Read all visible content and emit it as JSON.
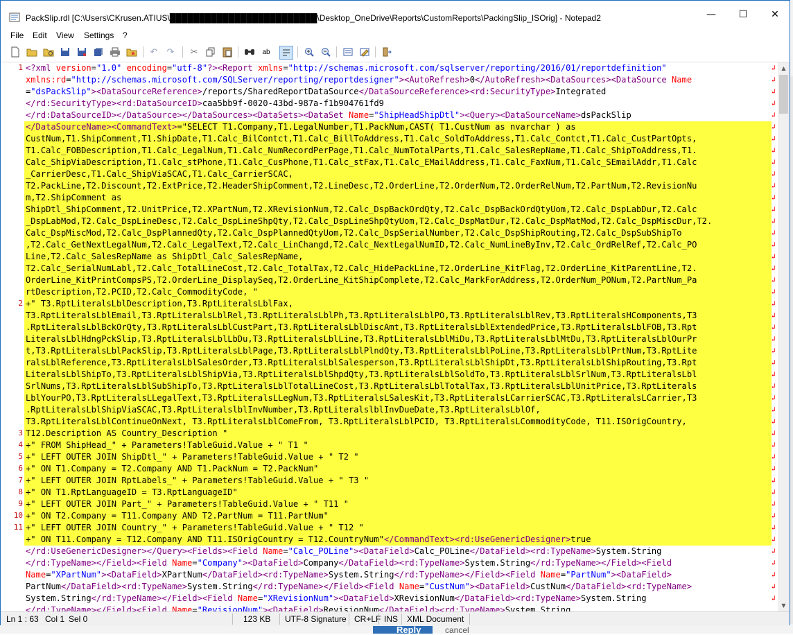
{
  "window": {
    "title": "PackSlip.rdl [C:\\Users\\CKrusen.ATIUS\\█████████████████████████\\Desktop_OneDrive\\Reports\\CustomReports\\PackingSlip_ISOrig] - Notepad2",
    "minimize_glyph": "—",
    "maximize_glyph": "☐",
    "close_glyph": "✕"
  },
  "menu": [
    "File",
    "Edit",
    "View",
    "Settings",
    "?"
  ],
  "toolbar": {
    "icons": [
      "new-file-icon",
      "open-file-icon",
      "browse-icon",
      "save-icon",
      "save-as-icon",
      "save-copy-icon",
      "print-icon",
      "favorites-icon",
      "undo-icon",
      "redo-icon",
      "cut-icon",
      "copy-icon",
      "paste-icon",
      "find-icon",
      "replace-icon",
      "word-wrap-icon",
      "zoom-in-icon",
      "zoom-out-icon",
      "scheme-icon",
      "customize-scheme-icon",
      "exit-icon"
    ]
  },
  "editor": {
    "line_numbers": [
      {
        "label": "1",
        "row": 0
      },
      {
        "label": "2",
        "row": 20
      },
      {
        "label": "3",
        "row": 31
      },
      {
        "label": "4",
        "row": 32
      },
      {
        "label": "5",
        "row": 33
      },
      {
        "label": "6",
        "row": 34
      },
      {
        "label": "7",
        "row": 35
      },
      {
        "label": "8",
        "row": 36
      },
      {
        "label": "9",
        "row": 37
      },
      {
        "label": "10",
        "row": 38
      },
      {
        "label": "11",
        "row": 39
      }
    ],
    "rows": [
      {
        "t": [
          [
            "tag",
            "<?xml "
          ],
          [
            "an",
            "version"
          ],
          [
            "",
            "="
          ],
          [
            "av",
            "\"1.0\""
          ],
          [
            "an",
            " encoding"
          ],
          [
            "",
            "="
          ],
          [
            "av",
            "\"utf-8\""
          ],
          [
            "tag",
            "?><Report "
          ],
          [
            "an",
            "xmlns"
          ],
          [
            "",
            "="
          ],
          [
            "av",
            "\"http://schemas.microsoft.com/sqlserver/reporting/2016/01/reportdefinition\""
          ]
        ]
      },
      {
        "t": [
          [
            "an",
            "xmlns:rd"
          ],
          [
            "",
            "="
          ],
          [
            "av",
            "\"http://schemas.microsoft.com/SQLServer/reporting/reportdesigner\""
          ],
          [
            "tag",
            "><AutoRefresh>"
          ],
          [
            "",
            "0"
          ],
          [
            "tag",
            "</AutoRefresh><DataSources><DataSource "
          ],
          [
            "an",
            "Name"
          ]
        ]
      },
      {
        "t": [
          [
            "",
            "="
          ],
          [
            "av",
            "\"dsPackSlip\""
          ],
          [
            "tag",
            "><DataSourceReference>"
          ],
          [
            "",
            "/reports/SharedReportDataSource"
          ],
          [
            "tag",
            "</DataSourceReference><rd:SecurityType>"
          ],
          [
            "",
            "Integrated"
          ]
        ]
      },
      {
        "t": [
          [
            "tag",
            "</rd:SecurityType><rd:DataSourceID>"
          ],
          [
            "",
            "caa5bb9f-0020-43bd-987a-f1b904761fd9"
          ]
        ]
      },
      {
        "t": [
          [
            "tag",
            "</rd:DataSourceID></DataSource></DataSources><DataSets><DataSet "
          ],
          [
            "an",
            "Name"
          ],
          [
            "",
            "="
          ],
          [
            "av",
            "\"ShipHeadShipDtl\""
          ],
          [
            "tag",
            "><Query><DataSourceName>"
          ],
          [
            "",
            "dsPackSlip"
          ]
        ]
      },
      {
        "h": 1,
        "t": [
          [
            "tag",
            "</DataSourceName><CommandText>"
          ],
          [
            "",
            "=\"SELECT T1.Company,T1.LegalNumber,T1.PackNum,CAST( T1.CustNum as nvarchar ) as"
          ]
        ]
      },
      {
        "h": 1,
        "t": [
          [
            "",
            "CustNum,T1.ShipComment,T1.ShipDate,T1.Calc_BilContct,T1.Calc_BillToAddress,T1.Calc_SoldToAddress,T1.Calc_Contct,T1.Calc_CustPartOpts,"
          ]
        ]
      },
      {
        "h": 1,
        "t": [
          [
            "",
            "T1.Calc_FOBDescription,T1.Calc_LegalNum,T1.Calc_NumRecordPerPage,T1.Calc_NumTotalParts,T1.Calc_SalesRepName,T1.Calc_ShipToAddress,T1."
          ]
        ]
      },
      {
        "h": 1,
        "t": [
          [
            "",
            "Calc_ShipViaDescription,T1.Calc_stPhone,T1.Calc_CusPhone,T1.Calc_stFax,T1.Calc_EMailAddress,T1.Calc_FaxNum,T1.Calc_SEmailAddr,T1.Calc"
          ]
        ]
      },
      {
        "h": 1,
        "t": [
          [
            "",
            "_CarrierDesc,T1.Calc_ShipViaSCAC,T1.Calc_CarrierSCAC,"
          ]
        ]
      },
      {
        "h": 1,
        "t": [
          [
            "",
            "T2.PackLine,T2.Discount,T2.ExtPrice,T2.HeaderShipComment,T2.LineDesc,T2.OrderLine,T2.OrderNum,T2.OrderRelNum,T2.PartNum,T2.RevisionNu"
          ]
        ]
      },
      {
        "h": 1,
        "t": [
          [
            "",
            "m,T2.ShipComment as"
          ]
        ]
      },
      {
        "h": 1,
        "t": [
          [
            "",
            "ShipDtl_ShipComment,T2.UnitPrice,T2.XPartNum,T2.XRevisionNum,T2.Calc_DspBackOrdQty,T2.Calc_DspBackOrdQtyUom,T2.Calc_DspLabDur,T2.Calc"
          ]
        ]
      },
      {
        "h": 1,
        "t": [
          [
            "",
            "_DspLabMod,T2.Calc_DspLineDesc,T2.Calc_DspLineShpQty,T2.Calc_DspLineShpQtyUom,T2.Calc_DspMatDur,T2.Calc_DspMatMod,T2.Calc_DspMiscDur,T2."
          ]
        ]
      },
      {
        "h": 1,
        "t": [
          [
            "",
            "Calc_DspMiscMod,T2.Calc_DspPlannedQty,T2.Calc_DspPlannedQtyUom,T2.Calc_DspSerialNumber,T2.Calc_DspShipRouting,T2.Calc_DspSubShipTo"
          ]
        ]
      },
      {
        "h": 1,
        "t": [
          [
            "",
            ",T2.Calc_GetNextLegalNum,T2.Calc_LegalText,T2.Calc_LinChangd,T2.Calc_NextLegalNumID,T2.Calc_NumLineByInv,T2.Calc_OrdRelRef,T2.Calc_PO"
          ]
        ]
      },
      {
        "h": 1,
        "t": [
          [
            "",
            "Line,T2.Calc_SalesRepName as ShipDtl_Calc_SalesRepName,"
          ]
        ]
      },
      {
        "h": 1,
        "t": [
          [
            "",
            "T2.Calc_SerialNumLabl,T2.Calc_TotalLineCost,T2.Calc_TotalTax,T2.Calc_HidePackLine,T2.OrderLine_KitFlag,T2.OrderLine_KitParentLine,T2."
          ]
        ]
      },
      {
        "h": 1,
        "t": [
          [
            "",
            "OrderLine_KitPrintCompsPS,T2.OrderLine_DisplaySeq,T2.OrderLine_KitShipComplete,T2.Calc_MarkForAddress,T2.OrderNum_PONum,T2.PartNum_Pa"
          ]
        ]
      },
      {
        "h": 1,
        "t": [
          [
            "",
            "rtDescription,T2.PCID,T2.Calc_CommodityCode, \""
          ]
        ]
      },
      {
        "h": 1,
        "t": [
          [
            "",
            "+\" T3.RptLiteralsLblDescription,T3.RptLiteralsLblFax,"
          ]
        ]
      },
      {
        "h": 1,
        "t": [
          [
            "",
            "T3.RptLiteralsLblEmail,T3.RptLiteralsLblRel,T3.RptLiteralsLblPh,T3.RptLiteralsLblPO,T3.RptLiteralsLblRev,T3.RptLiteralsHComponents,T3"
          ]
        ]
      },
      {
        "h": 1,
        "t": [
          [
            "",
            ".RptLiteralsLblBckOrQty,T3.RptLiteralsLblCustPart,T3.RptLiteralsLblDiscAmt,T3.RptLiteralsLblExtendedPrice,T3.RptLiteralsLblFOB,T3.Rpt"
          ]
        ]
      },
      {
        "h": 1,
        "t": [
          [
            "",
            "LiteralsLblHdngPckSlip,T3.RptLiteralsLblLbDu,T3.RptLiteralsLblLine,T3.RptLiteralsLblMiDu,T3.RptLiteralsLblMtDu,T3.RptLiteralsLblOurPr"
          ]
        ]
      },
      {
        "h": 1,
        "t": [
          [
            "",
            "t,T3.RptLiteralsLblPackSlip,T3.RptLiteralsLblPage,T3.RptLiteralsLblPlndQty,T3.RptLiteralsLblPoLine,T3.RptLiteralsLblPrtNum,T3.RptLite"
          ]
        ]
      },
      {
        "h": 1,
        "t": [
          [
            "",
            "ralsLblReference,T3.RptLiteralsLblSalesOrder,T3.RptLiteralsLblSalesperson,T3.RptLiteralsLblShipDt,T3.RptLiteralsLblShipRouting,T3.Rpt"
          ]
        ]
      },
      {
        "h": 1,
        "t": [
          [
            "",
            "LiteralsLblShipTo,T3.RptLiteralsLblShipVia,T3.RptLiteralsLblShpdQty,T3.RptLiteralsLblSoldTo,T3.RptLiteralsLblSrlNum,T3.RptLiteralsLbl"
          ]
        ]
      },
      {
        "h": 1,
        "t": [
          [
            "",
            "SrlNums,T3.RptLiteralsLblSubShipTo,T3.RptLiteralsLblTotalLineCost,T3.RptLiteralsLblTotalTax,T3.RptLiteralsLblUnitPrice,T3.RptLiterals"
          ]
        ]
      },
      {
        "h": 1,
        "t": [
          [
            "",
            "LblYourPO,T3.RptLiteralsLLegalText,T3.RptLiteralsLLegNum,T3.RptLiteralsLSalesKit,T3.RptLiteralsLCarrierSCAC,T3.RptLiteralsLCarrier,T3"
          ]
        ]
      },
      {
        "h": 1,
        "t": [
          [
            "",
            ".RptLiteralsLblShipViaSCAC,T3.RptLiteralslblInvNumber,T3.RptLiteralslblInvDueDate,T3.RptLiteralsLblOf,"
          ]
        ]
      },
      {
        "h": 1,
        "t": [
          [
            "",
            "T3.RptLiteralsLblContinueOnNext, T3.RptLiteralsLblComeFrom, T3.RptLiteralsLblPCID, T3.RptLiteralsLCommodityCode, T11.ISOrigCountry,"
          ]
        ]
      },
      {
        "h": 1,
        "t": [
          [
            "",
            "T12.Description AS Country_Description \""
          ]
        ]
      },
      {
        "h": 1,
        "t": [
          [
            "",
            "+\" FROM ShipHead_\" + Parameters!TableGuid.Value + \" T1 \""
          ]
        ]
      },
      {
        "h": 1,
        "t": [
          [
            "",
            "+\" LEFT OUTER JOIN ShipDtl_\" + Parameters!TableGuid.Value + \" T2 \""
          ]
        ]
      },
      {
        "h": 1,
        "t": [
          [
            "",
            "+\" ON T1.Company = T2.Company AND T1.PackNum = T2.PackNum\""
          ]
        ]
      },
      {
        "h": 1,
        "t": [
          [
            "",
            "+\" LEFT OUTER JOIN RptLabels_\" + Parameters!TableGuid.Value + \" T3 \""
          ]
        ]
      },
      {
        "h": 1,
        "t": [
          [
            "",
            "+\" ON T1.RptLanguageID = T3.RptLanguageID\""
          ]
        ]
      },
      {
        "h": 1,
        "t": [
          [
            "",
            "+\" LEFT OUTER JOIN Part_\" + Parameters!TableGuid.Value + \" T11 \""
          ]
        ]
      },
      {
        "h": 1,
        "t": [
          [
            "",
            "+\" ON T2.Company = T11.Company AND T2.PartNum = T11.PartNum\""
          ]
        ]
      },
      {
        "h": 1,
        "t": [
          [
            "",
            "+\" LEFT OUTER JOIN Country_\" + Parameters!TableGuid.Value + \" T12 \""
          ]
        ]
      },
      {
        "h": 2,
        "t": [
          [
            "",
            "+\" ON T11.Company = T12.Company AND T11.ISOrigCountry = T12.CountryNum\""
          ],
          [
            "tag",
            "</CommandText><rd:UseGenericDesigner>"
          ],
          [
            "",
            "true"
          ]
        ]
      },
      {
        "t": [
          [
            "tag",
            "</rd:UseGenericDesigner></Query><Fields><Field "
          ],
          [
            "an",
            "Name"
          ],
          [
            "",
            "="
          ],
          [
            "av",
            "\"Calc_POLine\""
          ],
          [
            "tag",
            "><DataField>"
          ],
          [
            "",
            "Calc_POLine"
          ],
          [
            "tag",
            "</DataField><rd:TypeName>"
          ],
          [
            "",
            "System.String"
          ]
        ]
      },
      {
        "t": [
          [
            "tag",
            "</rd:TypeName></Field><Field "
          ],
          [
            "an",
            "Name"
          ],
          [
            "",
            "="
          ],
          [
            "av",
            "\"Company\""
          ],
          [
            "tag",
            "><DataField>"
          ],
          [
            "",
            "Company"
          ],
          [
            "tag",
            "</DataField><rd:TypeName>"
          ],
          [
            "",
            "System.String"
          ],
          [
            "tag",
            "</rd:TypeName></Field><Field"
          ]
        ]
      },
      {
        "t": [
          [
            "an",
            "Name"
          ],
          [
            "",
            "="
          ],
          [
            "av",
            "\"XPartNum\""
          ],
          [
            "tag",
            "><DataField>"
          ],
          [
            "",
            "XPartNum"
          ],
          [
            "tag",
            "</DataField><rd:TypeName>"
          ],
          [
            "",
            "System.String"
          ],
          [
            "tag",
            "</rd:TypeName></Field><Field "
          ],
          [
            "an",
            "Name"
          ],
          [
            "",
            "="
          ],
          [
            "av",
            "\"PartNum\""
          ],
          [
            "tag",
            "><DataField>"
          ]
        ]
      },
      {
        "t": [
          [
            "",
            "PartNum"
          ],
          [
            "tag",
            "</DataField><rd:TypeName>"
          ],
          [
            "",
            "System.String"
          ],
          [
            "tag",
            "</rd:TypeName></Field><Field "
          ],
          [
            "an",
            "Name"
          ],
          [
            "",
            "="
          ],
          [
            "av",
            "\"CustNum\""
          ],
          [
            "tag",
            "><DataField>"
          ],
          [
            "",
            "CustNum"
          ],
          [
            "tag",
            "</DataField><rd:TypeName>"
          ]
        ]
      },
      {
        "t": [
          [
            "",
            "System.String"
          ],
          [
            "tag",
            "</rd:TypeName></Field><Field "
          ],
          [
            "an",
            "Name"
          ],
          [
            "",
            "="
          ],
          [
            "av",
            "\"XRevisionNum\""
          ],
          [
            "tag",
            "><DataField>"
          ],
          [
            "",
            "XRevisionNum"
          ],
          [
            "tag",
            "</DataField><rd:TypeName>"
          ],
          [
            "",
            "System.String"
          ]
        ]
      },
      {
        "t": [
          [
            "tag",
            "</rd:TypeName></Field><Field "
          ],
          [
            "an",
            "Name"
          ],
          [
            "",
            "="
          ],
          [
            "av",
            "\"RevisionNum\""
          ],
          [
            "tag",
            "><DataField>"
          ],
          [
            "",
            "RevisionNum"
          ],
          [
            "tag",
            "</DataField><rd:TypeName>"
          ],
          [
            "",
            "System.String"
          ]
        ]
      }
    ]
  },
  "statusbar": {
    "position": "Ln 1 : 63",
    "col": "Col 1",
    "sel": "Sel 0",
    "size": "123 KB",
    "encoding": "UTF-8 Signature",
    "eol": "CR+LF",
    "ins": "INS",
    "scheme": "XML Document"
  },
  "background": {
    "reply_label": "Reply",
    "cancel_label": "cancel"
  },
  "colors": {
    "highlight": "#ffff42",
    "tag": "#800080",
    "attr_name": "#ff0000",
    "attr_value": "#0000ff",
    "line_number": "#c01010"
  }
}
